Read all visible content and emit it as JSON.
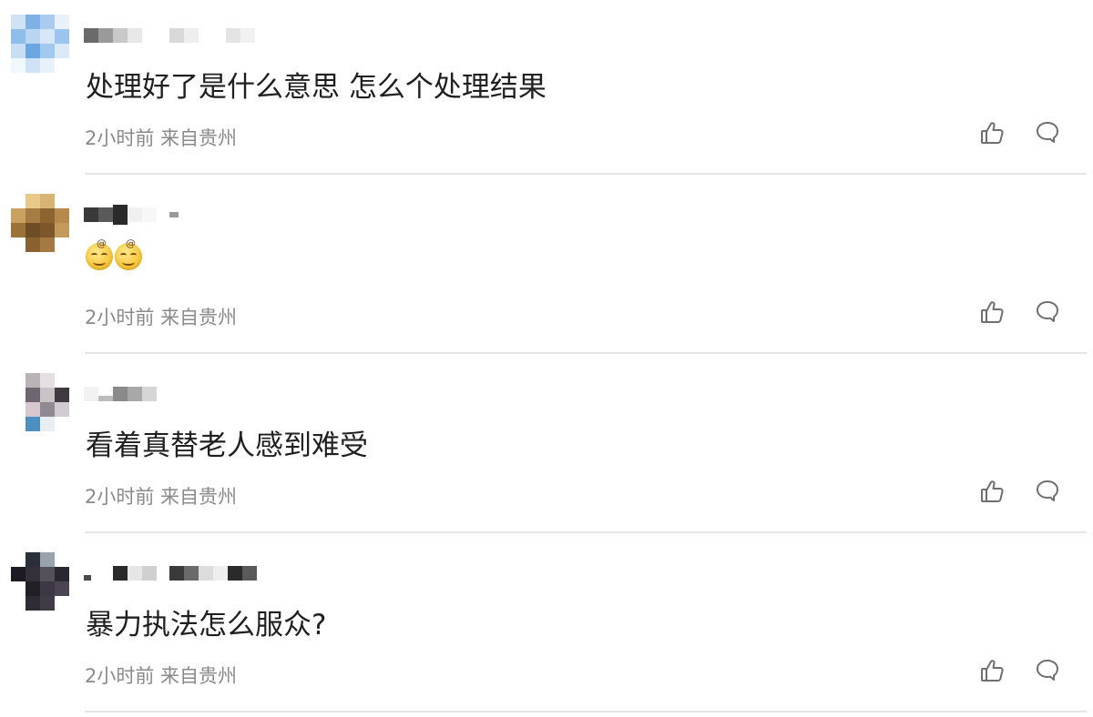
{
  "comments": [
    {
      "text": "处理好了是什么意思 怎么个处理结果",
      "emoji_count": 0,
      "meta": "2小时前 来自贵州"
    },
    {
      "text": "",
      "emoji_count": 2,
      "meta": "2小时前 来自贵州"
    },
    {
      "text": "看着真替老人感到难受",
      "emoji_count": 0,
      "meta": "2小时前 来自贵州"
    },
    {
      "text": "暴力执法怎么服众?",
      "emoji_count": 0,
      "meta": "2小时前 来自贵州"
    }
  ],
  "icons": {
    "like": "thumbs-up-icon",
    "reply": "speech-bubble-icon"
  },
  "colors": {
    "meta_text": "#8a8a8a",
    "comment_text": "#1f1f1f",
    "divider": "#e6e6e6",
    "icon_stroke": "#6f6f6f"
  }
}
